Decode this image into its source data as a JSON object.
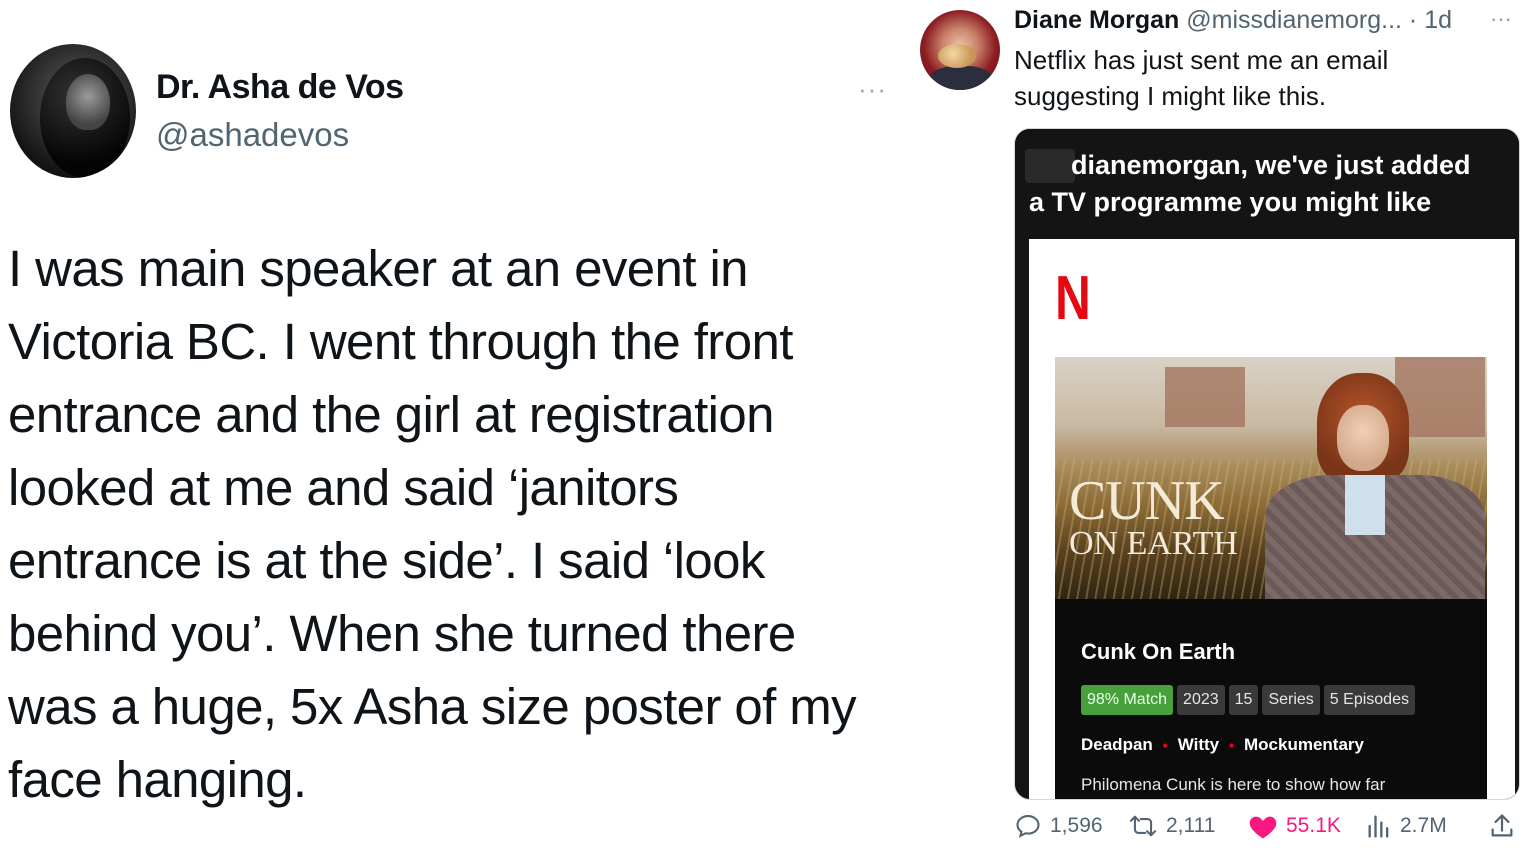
{
  "left_tweet": {
    "author_name": "Dr. Asha de Vos",
    "handle": "@ashadevos",
    "more_label": "···",
    "lines": [
      "I was main speaker at an event in",
      "Victoria BC. I went through the front",
      "entrance and the girl at registration",
      "looked at me and said ‘janitors",
      "entrance is at the side’. I said ‘look",
      "behind you’. When she turned there",
      "was a huge, 5x Asha size poster of my",
      "face hanging."
    ]
  },
  "right_tweet": {
    "author_name": "Diane Morgan",
    "meta": "@missdianemorg... · 1d",
    "more_label": "···",
    "text": "Netflix has just sent me an email suggesting I might like this.",
    "email": {
      "heading_line1": "dianemorgan, we've just added",
      "heading_line2": "a TV programme you might like",
      "logo": "N",
      "poster_title_line1": "CUNK",
      "poster_title_line2": "ON EARTH",
      "show_title": "Cunk On Earth",
      "badges": [
        "98% Match",
        "2023",
        "15",
        "Series",
        "5 Episodes"
      ],
      "tags": [
        "Deadpan",
        "Witty",
        "Mockumentary"
      ],
      "tag_separator": "•",
      "description": "Philomena Cunk is here to show how far"
    },
    "actions": {
      "replies": "1,596",
      "retweets": "2,111",
      "likes": "55.1K",
      "views": "2.7M"
    }
  },
  "colors": {
    "secondary_text": "#536471",
    "like_pink": "#f91880",
    "netflix_red": "#e50914",
    "match_green": "#46a13a"
  },
  "icons": [
    "reply-icon",
    "retweet-icon",
    "heart-icon",
    "views-icon",
    "share-icon",
    "more-icon"
  ]
}
